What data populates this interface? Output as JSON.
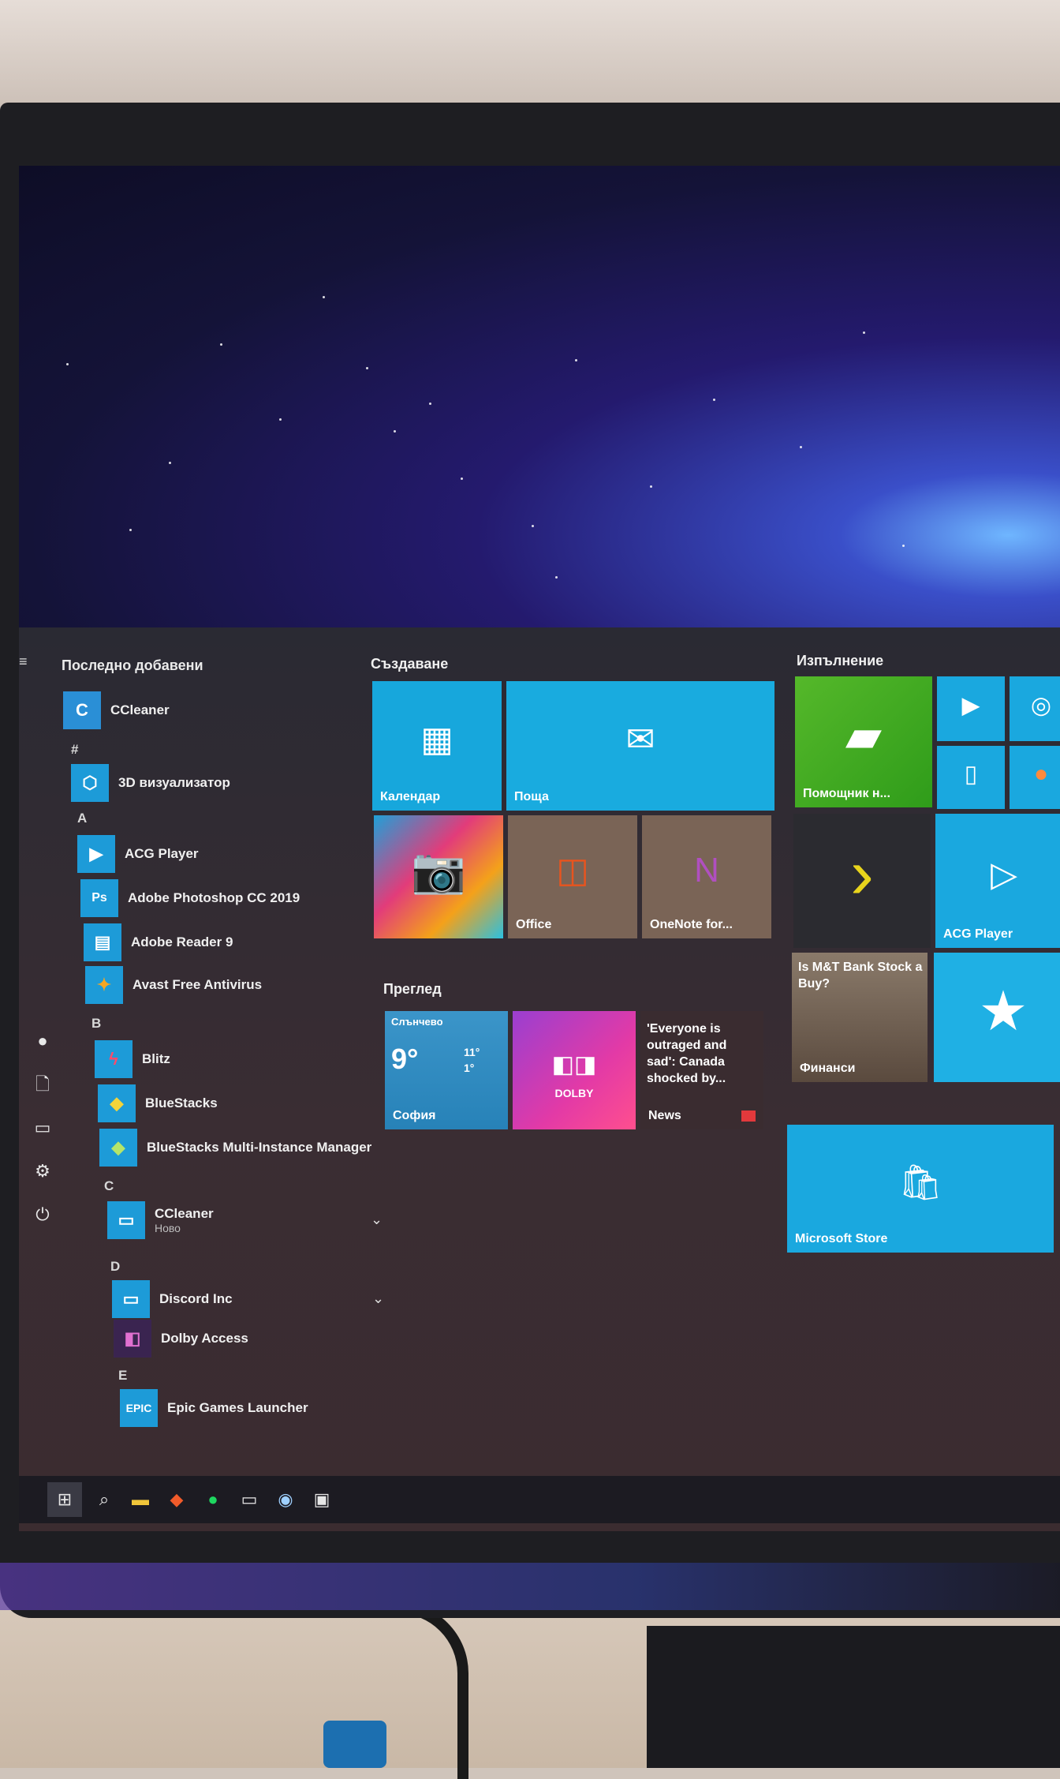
{
  "start_menu": {
    "recent_header": "Последно добавени",
    "apps": [
      {
        "label": "CCleaner",
        "icon": "ccleaner-icon",
        "color": "#2a8fd6"
      },
      {
        "letter": "#"
      },
      {
        "label": "3D визуализатор",
        "icon": "cube-icon",
        "color": "#1d9bd8"
      },
      {
        "letter": "A"
      },
      {
        "label": "ACG Player",
        "icon": "play-icon",
        "color": "#1d9bd8"
      },
      {
        "label": "Adobe Photoshop CC 2019",
        "icon": "photoshop-icon",
        "color": "#1d9bd8"
      },
      {
        "label": "Adobe Reader 9",
        "icon": "document-icon",
        "color": "#1d9bd8"
      },
      {
        "label": "Avast Free Antivirus",
        "icon": "avast-icon",
        "color": "#1d9bd8"
      },
      {
        "letter": "B"
      },
      {
        "label": "Blitz",
        "icon": "blitz-icon",
        "color": "#1d9bd8"
      },
      {
        "label": "BlueStacks",
        "icon": "bluestacks-icon",
        "color": "#1d9bd8"
      },
      {
        "label": "BlueStacks Multi-Instance Manager",
        "icon": "bluestacks-icon",
        "color": "#1d9bd8"
      },
      {
        "letter": "C"
      },
      {
        "label": "CCleaner",
        "sub": "Ново",
        "icon": "folder-icon",
        "color": "#1d9bd8"
      },
      {
        "letter": "D"
      },
      {
        "label": "Discord Inc",
        "icon": "folder-icon",
        "color": "#1d9bd8"
      },
      {
        "label": "Dolby Access",
        "icon": "dolby-icon",
        "color": "#3a2450"
      },
      {
        "letter": "E"
      },
      {
        "label": "Epic Games Launcher",
        "icon": "epic-icon",
        "color": "#1d9bd8"
      }
    ],
    "groups": {
      "create": "Създаване",
      "play": "Изпълнение",
      "browse": "Преглед"
    },
    "tiles": {
      "calendar": "Календар",
      "mail": "Поща",
      "office": "Office",
      "onenote": "OneNote for...",
      "assistant": "Помощник н...",
      "acg": "ACG Player",
      "finance_headline": "Is M&T Bank Stock a Buy?",
      "finance_label": "Финанси",
      "store": "Microsoft Store",
      "weather_cond": "Слънчево",
      "weather_temp": "9°",
      "weather_high": "11°",
      "weather_low": "1°",
      "weather_city": "София",
      "news_headline": "'Everyone is outraged and sad': Canada shocked by...",
      "news_label": "News",
      "dolby": "DOLBY"
    }
  },
  "taskbar": {
    "icons": [
      "windows-icon",
      "search-icon",
      "file-explorer-icon",
      "brave-icon",
      "spotify-icon",
      "chat-icon",
      "steam-icon",
      "app-icon"
    ]
  }
}
